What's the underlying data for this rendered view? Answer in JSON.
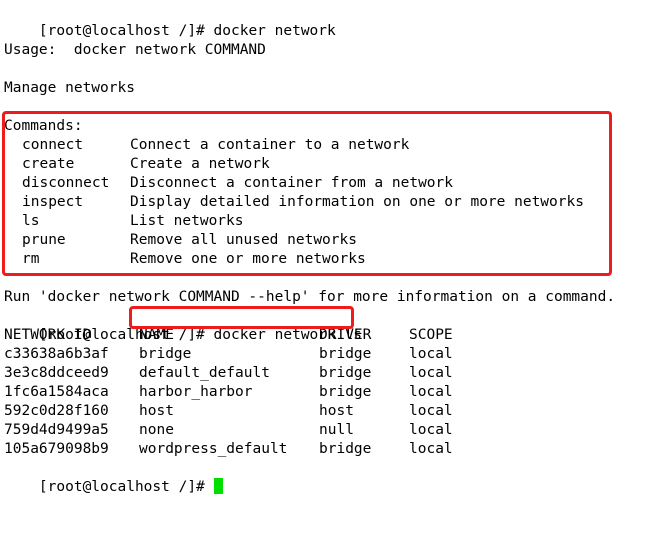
{
  "terminal": {
    "prompt": "[root@localhost /]# ",
    "command1": "docker network",
    "usage": "Usage:  docker network COMMAND",
    "description": "Manage networks",
    "commands_header": "Commands:",
    "commands": [
      {
        "name": "connect",
        "desc": "Connect a container to a network"
      },
      {
        "name": "create",
        "desc": "Create a network"
      },
      {
        "name": "disconnect",
        "desc": "Disconnect a container from a network"
      },
      {
        "name": "inspect",
        "desc": "Display detailed information on one or more networks"
      },
      {
        "name": "ls",
        "desc": "List networks"
      },
      {
        "name": "prune",
        "desc": "Remove all unused networks"
      },
      {
        "name": "rm",
        "desc": "Remove one or more networks"
      }
    ],
    "help_hint": "Run 'docker network COMMAND --help' for more information on a command.",
    "command2": "docker network ls",
    "table_headers": [
      "NETWORK ID",
      "NAME",
      "DRIVER",
      "SCOPE"
    ],
    "networks": [
      {
        "id": "c33638a6b3af",
        "name": "bridge",
        "driver": "bridge",
        "scope": "local"
      },
      {
        "id": "3e3c8ddceed9",
        "name": "default_default",
        "driver": "bridge",
        "scope": "local"
      },
      {
        "id": "1fc6a1584aca",
        "name": "harbor_harbor",
        "driver": "bridge",
        "scope": "local"
      },
      {
        "id": "592c0d28f160",
        "name": "host",
        "driver": "host",
        "scope": "local"
      },
      {
        "id": "759d4d9499a5",
        "name": "none",
        "driver": "null",
        "scope": "local"
      },
      {
        "id": "105a679098b9",
        "name": "wordpress_default",
        "driver": "bridge",
        "scope": "local"
      }
    ]
  },
  "colors": {
    "background": "#ffffff",
    "text": "#000000",
    "highlight_border": "#ee1c1c",
    "cursor": "#00e000"
  }
}
